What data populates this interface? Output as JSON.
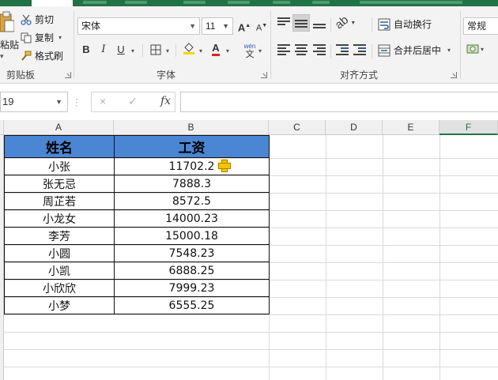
{
  "ribbon": {
    "clipboard": {
      "paste_label": "粘贴",
      "cut_label": "剪切",
      "copy_label": "复制",
      "format_painter_label": "格式刷",
      "group_label": "剪贴板"
    },
    "font": {
      "font_name": "宋体",
      "font_size": "11",
      "grow_label": "A",
      "shrink_label": "A",
      "bold_label": "B",
      "italic_label": "I",
      "underline_label": "U",
      "font_color_label": "A",
      "phonetic_top": "wén",
      "phonetic_bottom": "文",
      "group_label": "字体"
    },
    "alignment": {
      "wrap_text_label": "自动换行",
      "merge_center_label": "合并后居中",
      "group_label": "对齐方式"
    },
    "number": {
      "format_value": "常规"
    },
    "colors": {
      "fill_color": "#f5d400",
      "font_color": "#e02020",
      "accent": "#217346"
    }
  },
  "formula_bar": {
    "name_box_value": "19",
    "cancel_icon": "×",
    "enter_icon": "✓",
    "fx_label": "fx",
    "formula_value": ""
  },
  "columns": [
    "A",
    "B",
    "C",
    "D",
    "E",
    "F"
  ],
  "table": {
    "headers": [
      "姓名",
      "工资"
    ],
    "rows": [
      [
        "小张",
        "11702.2"
      ],
      [
        "张无忌",
        "7888.3"
      ],
      [
        "周芷若",
        "8572.5"
      ],
      [
        "小龙女",
        "14000.23"
      ],
      [
        "李芳",
        "15000.18"
      ],
      [
        "小圆",
        "7548.23"
      ],
      [
        "小凯",
        "6888.25"
      ],
      [
        "小欣欣",
        "7999.23"
      ],
      [
        "小梦",
        "6555.25"
      ]
    ],
    "header_fill": "#4a86d4"
  }
}
